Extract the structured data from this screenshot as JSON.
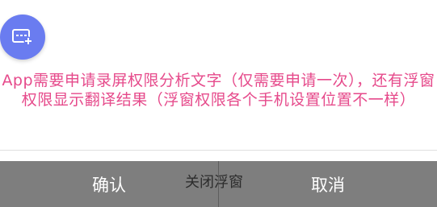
{
  "dialog": {
    "message": "App需要申请录屏权限分析文字（仅需要申请一次），还有浮窗权限显示翻译结果（浮窗权限各个手机设置位置不一样）"
  },
  "buttons": {
    "confirm_label": "确认",
    "cancel_label": "取消",
    "close_float_label": "关闭浮窗"
  },
  "icons": {
    "fab_icon": "screen-add-icon"
  },
  "colors": {
    "message_text": "#e64a8b",
    "fab_background": "#6a7cf0",
    "button_bar": "#7e7e7e"
  }
}
